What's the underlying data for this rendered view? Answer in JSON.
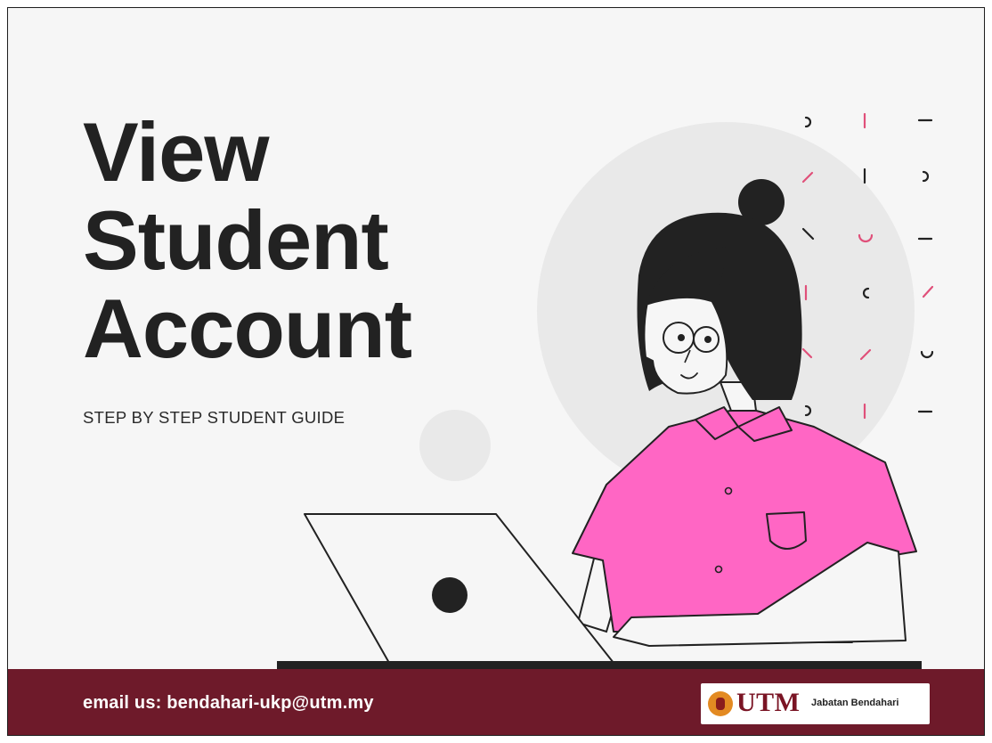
{
  "slide": {
    "title_lines": [
      "View",
      "Student",
      "Account"
    ],
    "subtitle": "STEP BY STEP STUDENT GUIDE",
    "illustration": "woman-using-laptop-illustration"
  },
  "footer": {
    "email_text": "email us: bendahari-ukp@utm.my",
    "logo": {
      "brand": "UTM",
      "department": "Jabatan Bendahari"
    }
  },
  "colors": {
    "footer_bg": "#6e1a2a",
    "accent_pink": "#ff66c4",
    "title_text": "#222222"
  }
}
